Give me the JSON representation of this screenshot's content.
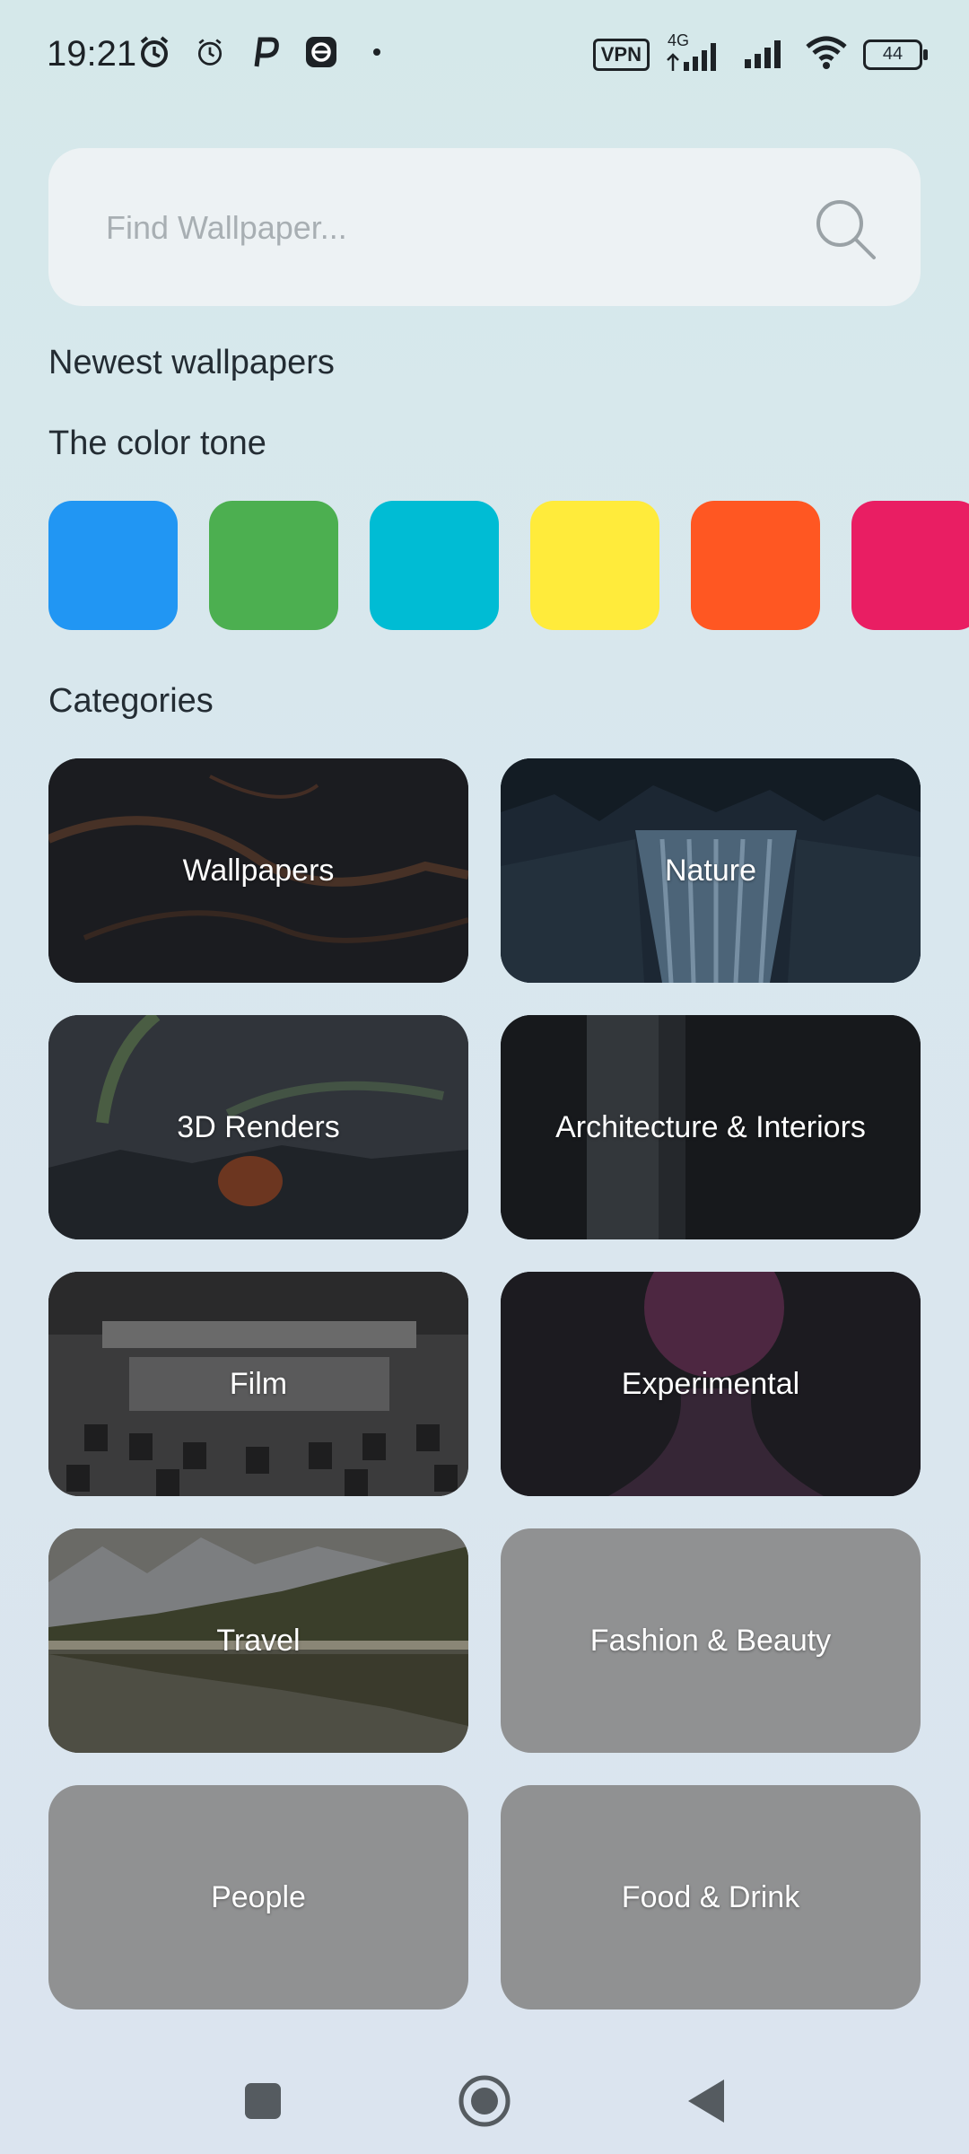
{
  "status_bar": {
    "time": "19:21",
    "vpn": "VPN",
    "network": "4G",
    "battery": "44"
  },
  "search": {
    "placeholder": "Find Wallpaper..."
  },
  "sections": {
    "newest": "Newest wallpapers",
    "color_tone": "The color tone",
    "categories": "Categories"
  },
  "color_tones": [
    "#2196F3",
    "#4CAF50",
    "#00BCD4",
    "#FFEB3B",
    "#FF5722",
    "#E91E63"
  ],
  "categories": [
    {
      "label": "Wallpapers"
    },
    {
      "label": "Nature"
    },
    {
      "label": "3D Renders"
    },
    {
      "label": "Architecture & Interiors"
    },
    {
      "label": "Film"
    },
    {
      "label": "Experimental"
    },
    {
      "label": "Travel"
    },
    {
      "label": "Fashion & Beauty"
    },
    {
      "label": "People"
    },
    {
      "label": "Food & Drink"
    }
  ],
  "nav": {
    "recents": "recents",
    "home": "home",
    "back": "back"
  }
}
